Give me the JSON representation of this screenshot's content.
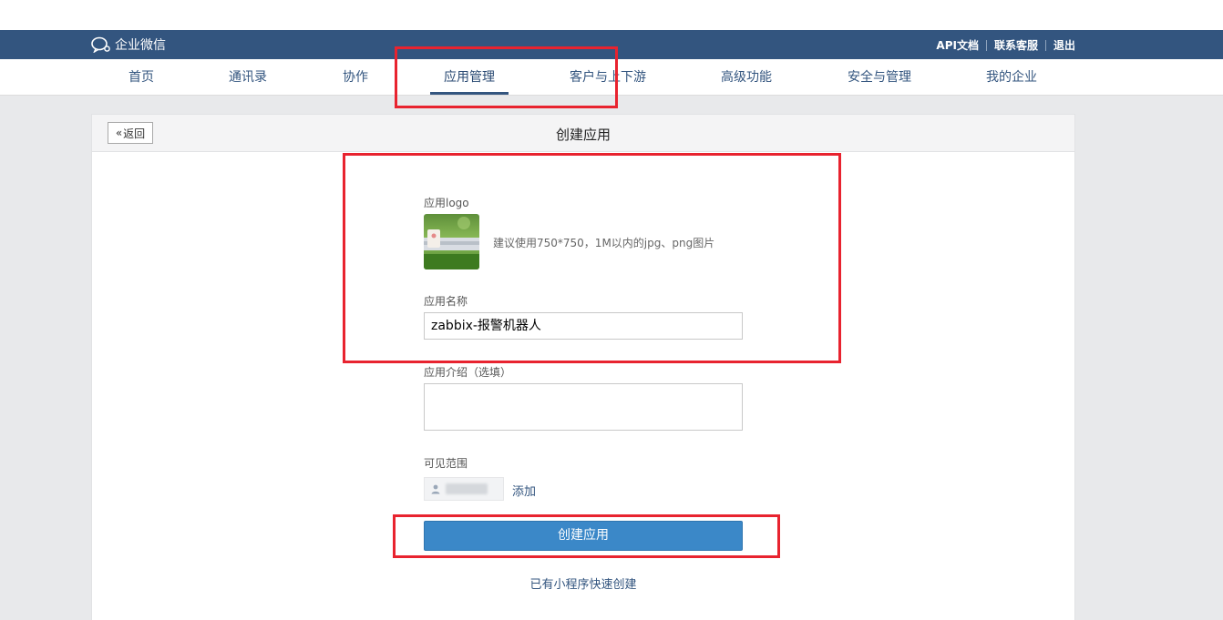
{
  "topbar": {
    "brand": "企业微信",
    "links": [
      "API文档",
      "联系客服",
      "退出"
    ]
  },
  "nav": {
    "items": [
      "首页",
      "通讯录",
      "协作",
      "应用管理",
      "客户与上下游",
      "高级功能",
      "安全与管理",
      "我的企业"
    ],
    "active": "应用管理"
  },
  "page": {
    "back_label": "返回",
    "title": "创建应用"
  },
  "form": {
    "logo_label": "应用logo",
    "logo_hint": "建议使用750*750，1M以内的jpg、png图片",
    "name_label": "应用名称",
    "name_value": "zabbix-报警机器人",
    "intro_label": "应用介绍（选填）",
    "intro_value": "",
    "visibility_label": "可见范围",
    "add_label": "添加",
    "submit_label": "创建应用",
    "mini_program_link": "已有小程序快速创建"
  },
  "colors": {
    "brand_bar": "#33557f",
    "primary_button": "#3b88c8",
    "annotation_red": "#e8232f"
  }
}
